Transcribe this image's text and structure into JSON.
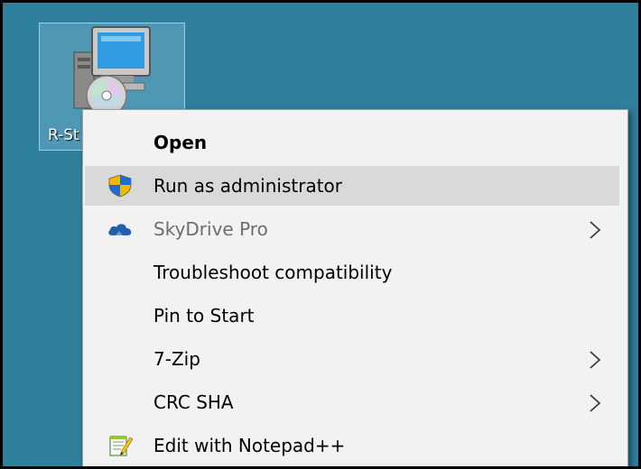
{
  "desktop": {
    "background_color": "#2e7f9c",
    "icon": {
      "name": "installer-cd-icon",
      "label": "R-St"
    }
  },
  "context_menu": {
    "items": [
      {
        "label": "Open",
        "bold": true,
        "icon": null,
        "submenu": false,
        "disabled": false,
        "highlighted": false
      },
      {
        "label": "Run as administrator",
        "bold": false,
        "icon": "uac-shield-icon",
        "submenu": false,
        "disabled": false,
        "highlighted": true
      },
      {
        "label": "SkyDrive Pro",
        "bold": false,
        "icon": "skydrive-cloud-icon",
        "submenu": true,
        "disabled": true,
        "highlighted": false
      },
      {
        "label": "Troubleshoot compatibility",
        "bold": false,
        "icon": null,
        "submenu": false,
        "disabled": false,
        "highlighted": false
      },
      {
        "label": "Pin to Start",
        "bold": false,
        "icon": null,
        "submenu": false,
        "disabled": false,
        "highlighted": false
      },
      {
        "label": "7-Zip",
        "bold": false,
        "icon": null,
        "submenu": true,
        "disabled": false,
        "highlighted": false
      },
      {
        "label": "CRC SHA",
        "bold": false,
        "icon": null,
        "submenu": true,
        "disabled": false,
        "highlighted": false
      },
      {
        "label": "Edit with Notepad++",
        "bold": false,
        "icon": "notepad-plus-plus-icon",
        "submenu": false,
        "disabled": false,
        "highlighted": false
      }
    ]
  },
  "colors": {
    "menu_background": "#f2f2f2",
    "highlight": "#d9d9d9",
    "disabled_text": "#6d6d6d"
  }
}
